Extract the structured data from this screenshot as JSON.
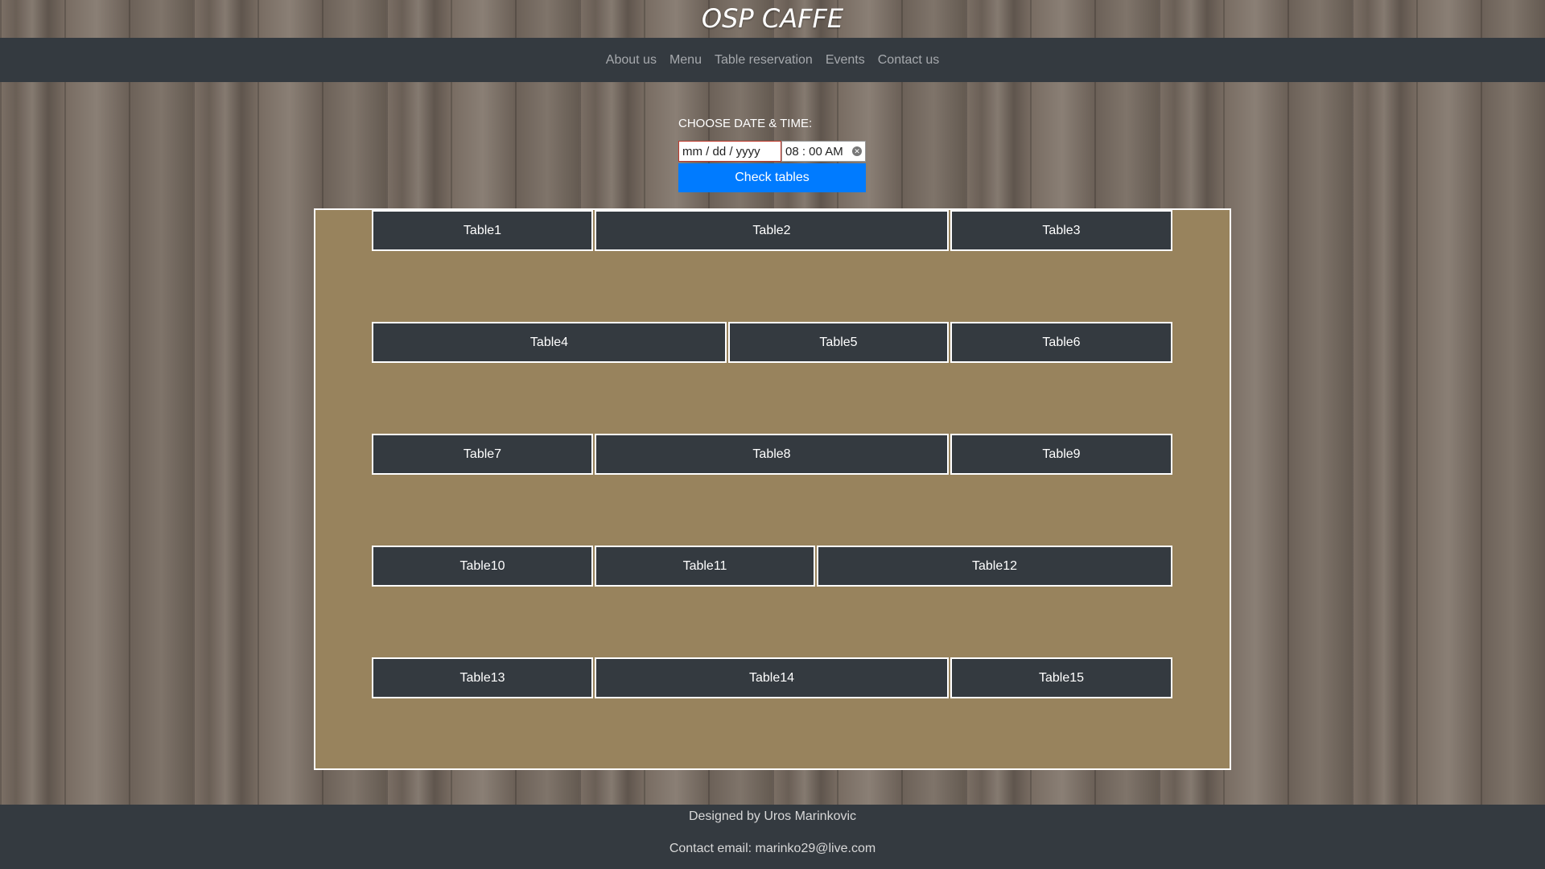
{
  "header": {
    "title": "OSP CAFFE"
  },
  "nav": {
    "items": [
      {
        "label": "About us"
      },
      {
        "label": "Menu"
      },
      {
        "label": "Table reservation"
      },
      {
        "label": "Events"
      },
      {
        "label": "Contact us"
      }
    ]
  },
  "reservation": {
    "label": "CHOOSE DATE & TIME:",
    "date_placeholder": "mm / dd / yyyy",
    "time_value": "08 : 00   AM",
    "check_button": "Check tables"
  },
  "tables": {
    "rows": [
      [
        {
          "label": "Table1"
        },
        {
          "label": "Table2"
        },
        {
          "label": "Table3"
        }
      ],
      [
        {
          "label": "Table4"
        },
        {
          "label": "Table5"
        },
        {
          "label": "Table6"
        }
      ],
      [
        {
          "label": "Table7"
        },
        {
          "label": "Table8"
        },
        {
          "label": "Table9"
        }
      ],
      [
        {
          "label": "Table10"
        },
        {
          "label": "Table11"
        },
        {
          "label": "Table12"
        }
      ],
      [
        {
          "label": "Table13"
        },
        {
          "label": "Table14"
        },
        {
          "label": "Table15"
        }
      ]
    ]
  },
  "footer": {
    "designed_by": "Designed by Uros Marinkovic",
    "contact": "Contact email: marinko29@live.com"
  },
  "colors": {
    "navbar": "#343a40",
    "accent": "#007bff",
    "floor": "#98835d"
  }
}
